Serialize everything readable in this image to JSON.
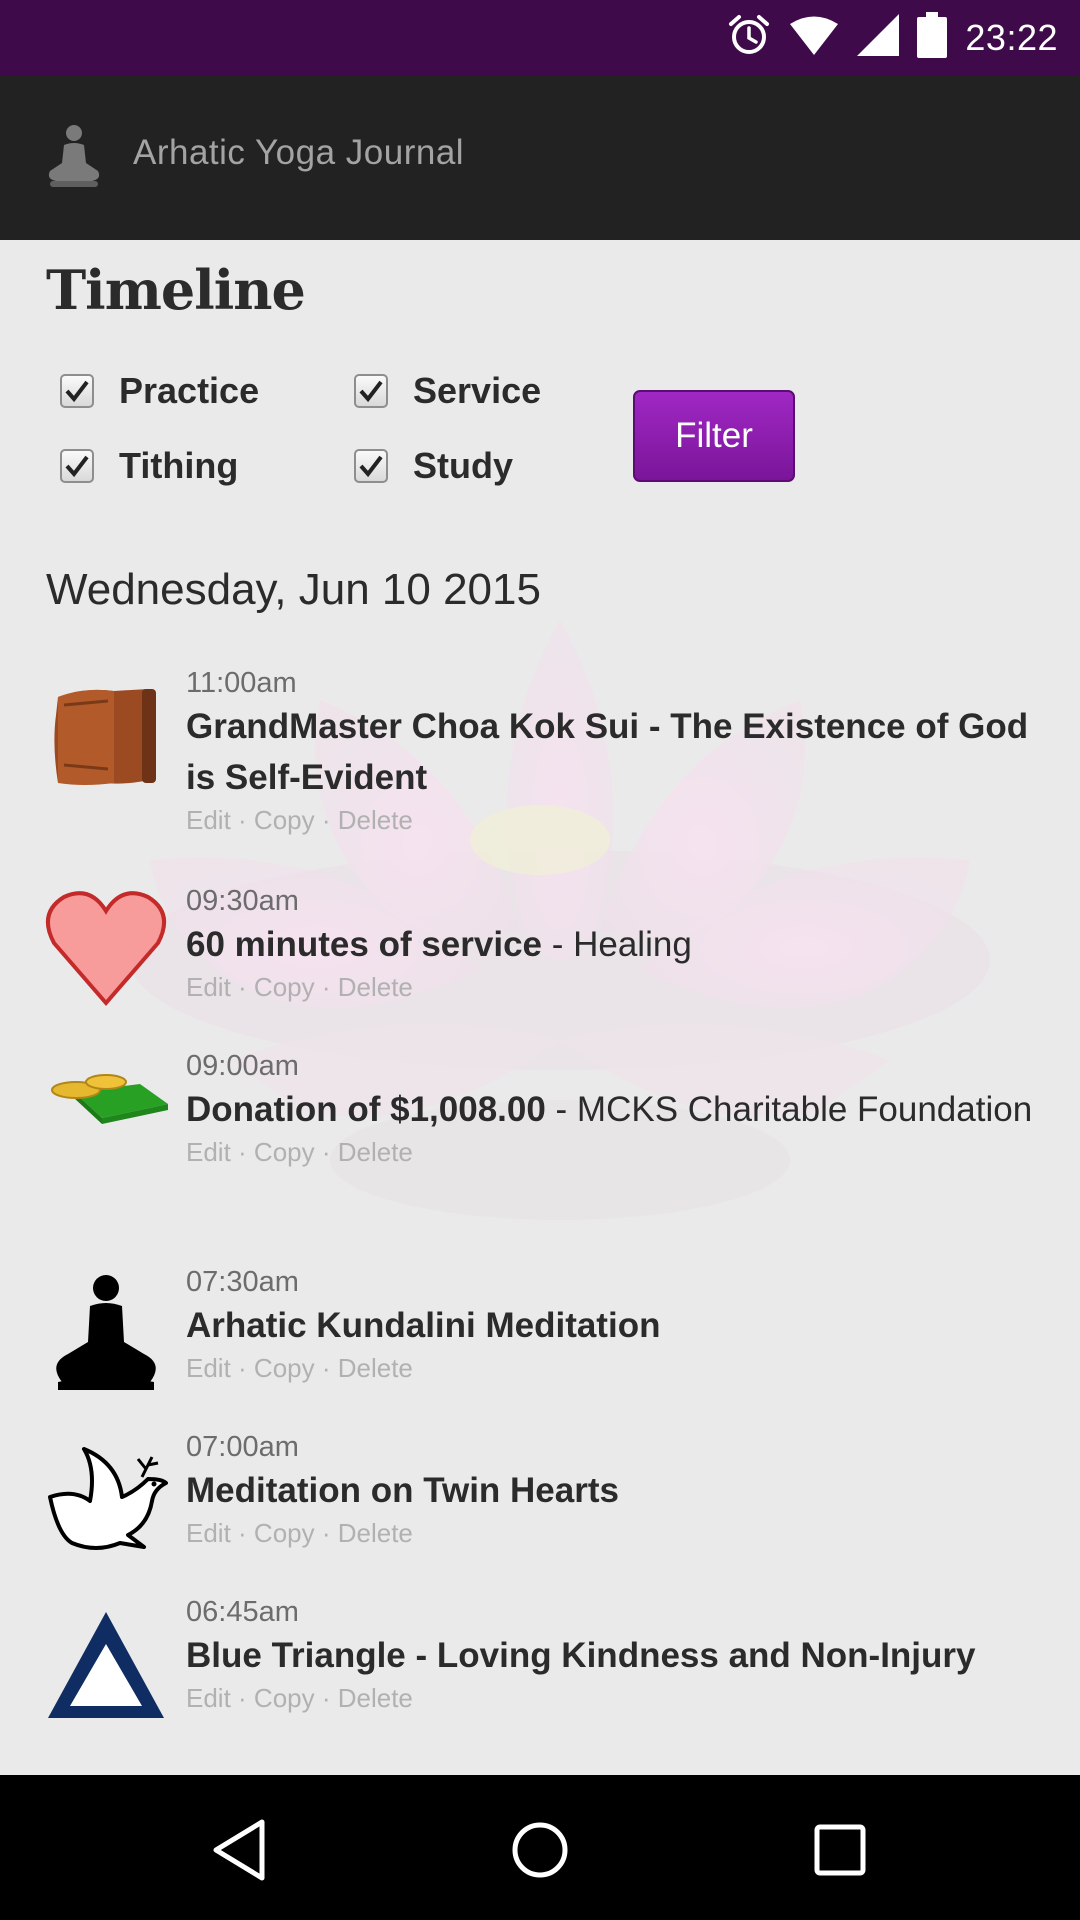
{
  "status_bar": {
    "time": "23:22",
    "icons": [
      "alarm-icon",
      "wifi-icon",
      "signal-icon",
      "battery-icon"
    ]
  },
  "app_bar": {
    "title": "Arhatic Yoga Journal",
    "logo_icon": "meditating-figure-icon"
  },
  "page": {
    "title": "Timeline",
    "filters": [
      {
        "label": "Practice",
        "checked": true
      },
      {
        "label": "Service",
        "checked": true
      },
      {
        "label": "Tithing",
        "checked": true
      },
      {
        "label": "Study",
        "checked": true
      }
    ],
    "filter_button": "Filter",
    "date_heading": "Wednesday, Jun 10 2015"
  },
  "entries": [
    {
      "time": "11:00am",
      "title": "GrandMaster Choa Kok Sui - The Existence of God is Self-Evident",
      "detail": "",
      "icon": "book-icon"
    },
    {
      "time": "09:30am",
      "title": "60 minutes of service",
      "detail": " - Healing",
      "icon": "heart-icon"
    },
    {
      "time": "09:00am",
      "title": "Donation of $1,008.00",
      "detail": " - MCKS Charitable Foundation",
      "icon": "money-icon"
    },
    {
      "time": "07:30am",
      "title": "Arhatic Kundalini Meditation",
      "detail": "",
      "icon": "meditation-icon"
    },
    {
      "time": "07:00am",
      "title": "Meditation on Twin Hearts",
      "detail": "",
      "icon": "dove-icon"
    },
    {
      "time": "06:45am",
      "title": "Blue Triangle - Loving Kindness and Non-Injury",
      "detail": "",
      "icon": "triangle-icon"
    }
  ],
  "entry_actions": {
    "edit": "Edit",
    "copy": "Copy",
    "delete": "Delete",
    "separator": " · "
  },
  "nav_bar": {
    "buttons": [
      "back-icon",
      "home-icon",
      "recents-icon"
    ]
  },
  "colors": {
    "status_bar": "#3f0a4a",
    "app_bar": "#222222",
    "accent": "#8e1cb0",
    "nav_bar": "#000000"
  }
}
